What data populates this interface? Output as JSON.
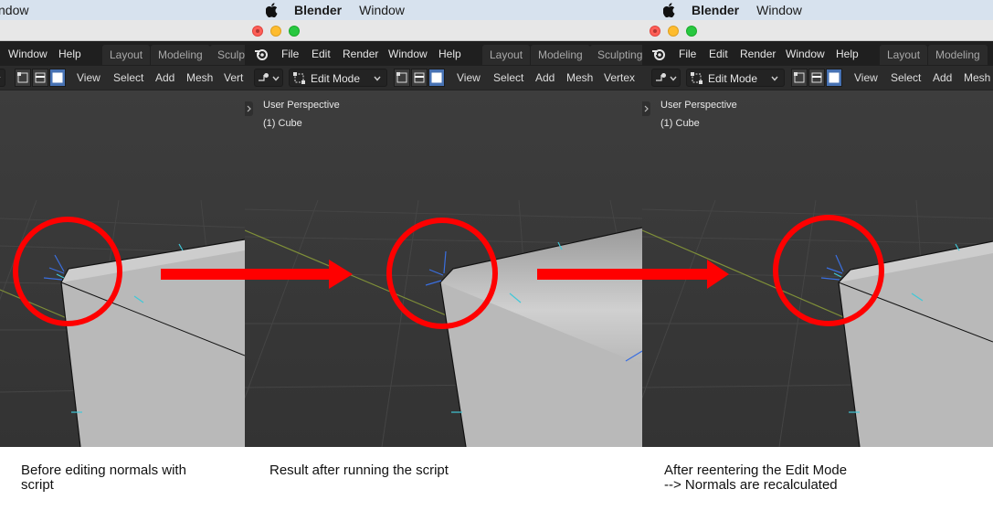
{
  "panels": [
    {
      "mac_menu": {
        "partial_item": "ndow"
      },
      "blender_menu": {
        "items": [
          "Window",
          "Help"
        ]
      },
      "workspace_tabs": [
        "Layout",
        "Modeling",
        "Sculpt"
      ],
      "viewport_header": {
        "items": [
          "View",
          "Select",
          "Add",
          "Mesh",
          "Vert"
        ]
      },
      "caption": "Before editing normals with\nscript"
    },
    {
      "mac_menu": {
        "app_name": "Blender",
        "item": "Window"
      },
      "blender_menu": {
        "items": [
          "File",
          "Edit",
          "Render",
          "Window",
          "Help"
        ]
      },
      "workspace_tabs": [
        "Layout",
        "Modeling",
        "Sculpting"
      ],
      "viewport_header": {
        "mode": "Edit Mode",
        "items": [
          "View",
          "Select",
          "Add",
          "Mesh",
          "Vertex"
        ]
      },
      "viewport_info": {
        "perspective": "User Perspective",
        "object": "(1) Cube"
      },
      "caption": "Result after running the script"
    },
    {
      "mac_menu": {
        "app_name": "Blender",
        "item": "Window"
      },
      "blender_menu": {
        "items": [
          "File",
          "Edit",
          "Render",
          "Window",
          "Help"
        ]
      },
      "workspace_tabs": [
        "Layout",
        "Modeling"
      ],
      "viewport_header": {
        "mode": "Edit Mode",
        "items": [
          "View",
          "Select",
          "Add",
          "Mesh"
        ]
      },
      "viewport_info": {
        "perspective": "User Perspective",
        "object": "(1) Cube"
      },
      "caption": "After reentering the Edit Mode\n--> Normals are recalculated"
    }
  ],
  "colors": {
    "annotation_red": "#ff0000",
    "viewport_bg": "#3a3a3a",
    "grid_line": "#4a4a4a",
    "x_axis": "#8a9a3a",
    "mesh_face": "#bdbdbd",
    "normal_blue": "#3a6fe0",
    "normal_cyan": "#40c8d8",
    "active_select_mode": "#4772b3"
  },
  "icons": [
    "apple-icon",
    "blender-logo-icon",
    "editor-type-icon",
    "edit-mode-icon",
    "chevron-down-icon",
    "vertex-select-icon",
    "edge-select-icon",
    "face-select-icon",
    "sidebar-toggle-icon"
  ]
}
